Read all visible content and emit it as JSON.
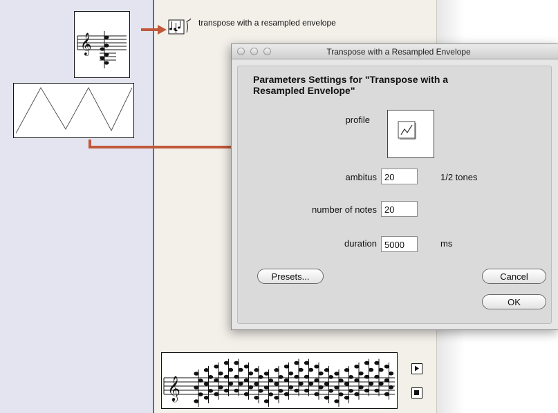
{
  "patch": {
    "function_label": "transpose with a resampled envelope"
  },
  "dialog": {
    "window_title": "Transpose with a Resampled Envelope",
    "heading": "Parameters Settings for \"Transpose with a Resampled Envelope\"",
    "fields": {
      "profile": {
        "label": "profile"
      },
      "ambitus": {
        "label": "ambitus",
        "value": "20",
        "unit": "1/2 tones"
      },
      "number_of_notes": {
        "label": "number of notes",
        "value": "20"
      },
      "duration": {
        "label": "duration",
        "value": "5000",
        "unit": "ms"
      }
    },
    "buttons": {
      "presets": "Presets...",
      "cancel": "Cancel",
      "ok": "OK"
    }
  },
  "colors": {
    "arrow": "#c0583a",
    "left_panel": "#e3e4ef",
    "mid_panel": "#f3f0ea",
    "dialog_bg": "#e6e6e6"
  }
}
